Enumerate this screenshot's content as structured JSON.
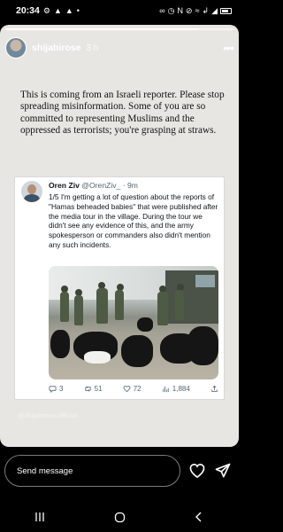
{
  "status_bar": {
    "time": "20:34",
    "left_icons": [
      "settings-gear-icon",
      "warning-icon",
      "warning-icon",
      "dot-icon"
    ],
    "right_icons": [
      "link-icon",
      "alarm-icon",
      "nfc-icon",
      "mute-icon",
      "wifi-icon",
      "volte-icon",
      "signal-icon",
      "battery-icon"
    ]
  },
  "story": {
    "progress": 0.85,
    "username": "shijabirose",
    "time_ago": "3 h",
    "caption": "This is coming from an Israeli reporter. Please stop spreading misinformation. Some of you are so committed to representing Muslims and the oppressed as terrorists; you're grasping at straws.",
    "watermark": "@shijabirose.official"
  },
  "tweet": {
    "name": "Oren Ziv",
    "handle": "@OrenZiv_ · 9m",
    "text": "1/5 I'm getting a lot of question about the reports of \"Hamas beheaded babies\" that were published after the media tour in the village. During the tour we didn't see any evidence of this, and the army spokesperson or commanders also didn't mention any such incidents.",
    "actions": {
      "replies": "3",
      "retweets": "51",
      "likes": "72",
      "views": "1,884"
    }
  },
  "bottom_bar": {
    "reply_placeholder": "Send message"
  },
  "colors": {
    "story_bg": "#e7e6e2",
    "tweet_text": "#0f1419",
    "tweet_muted": "#536471",
    "background": "#000000"
  }
}
